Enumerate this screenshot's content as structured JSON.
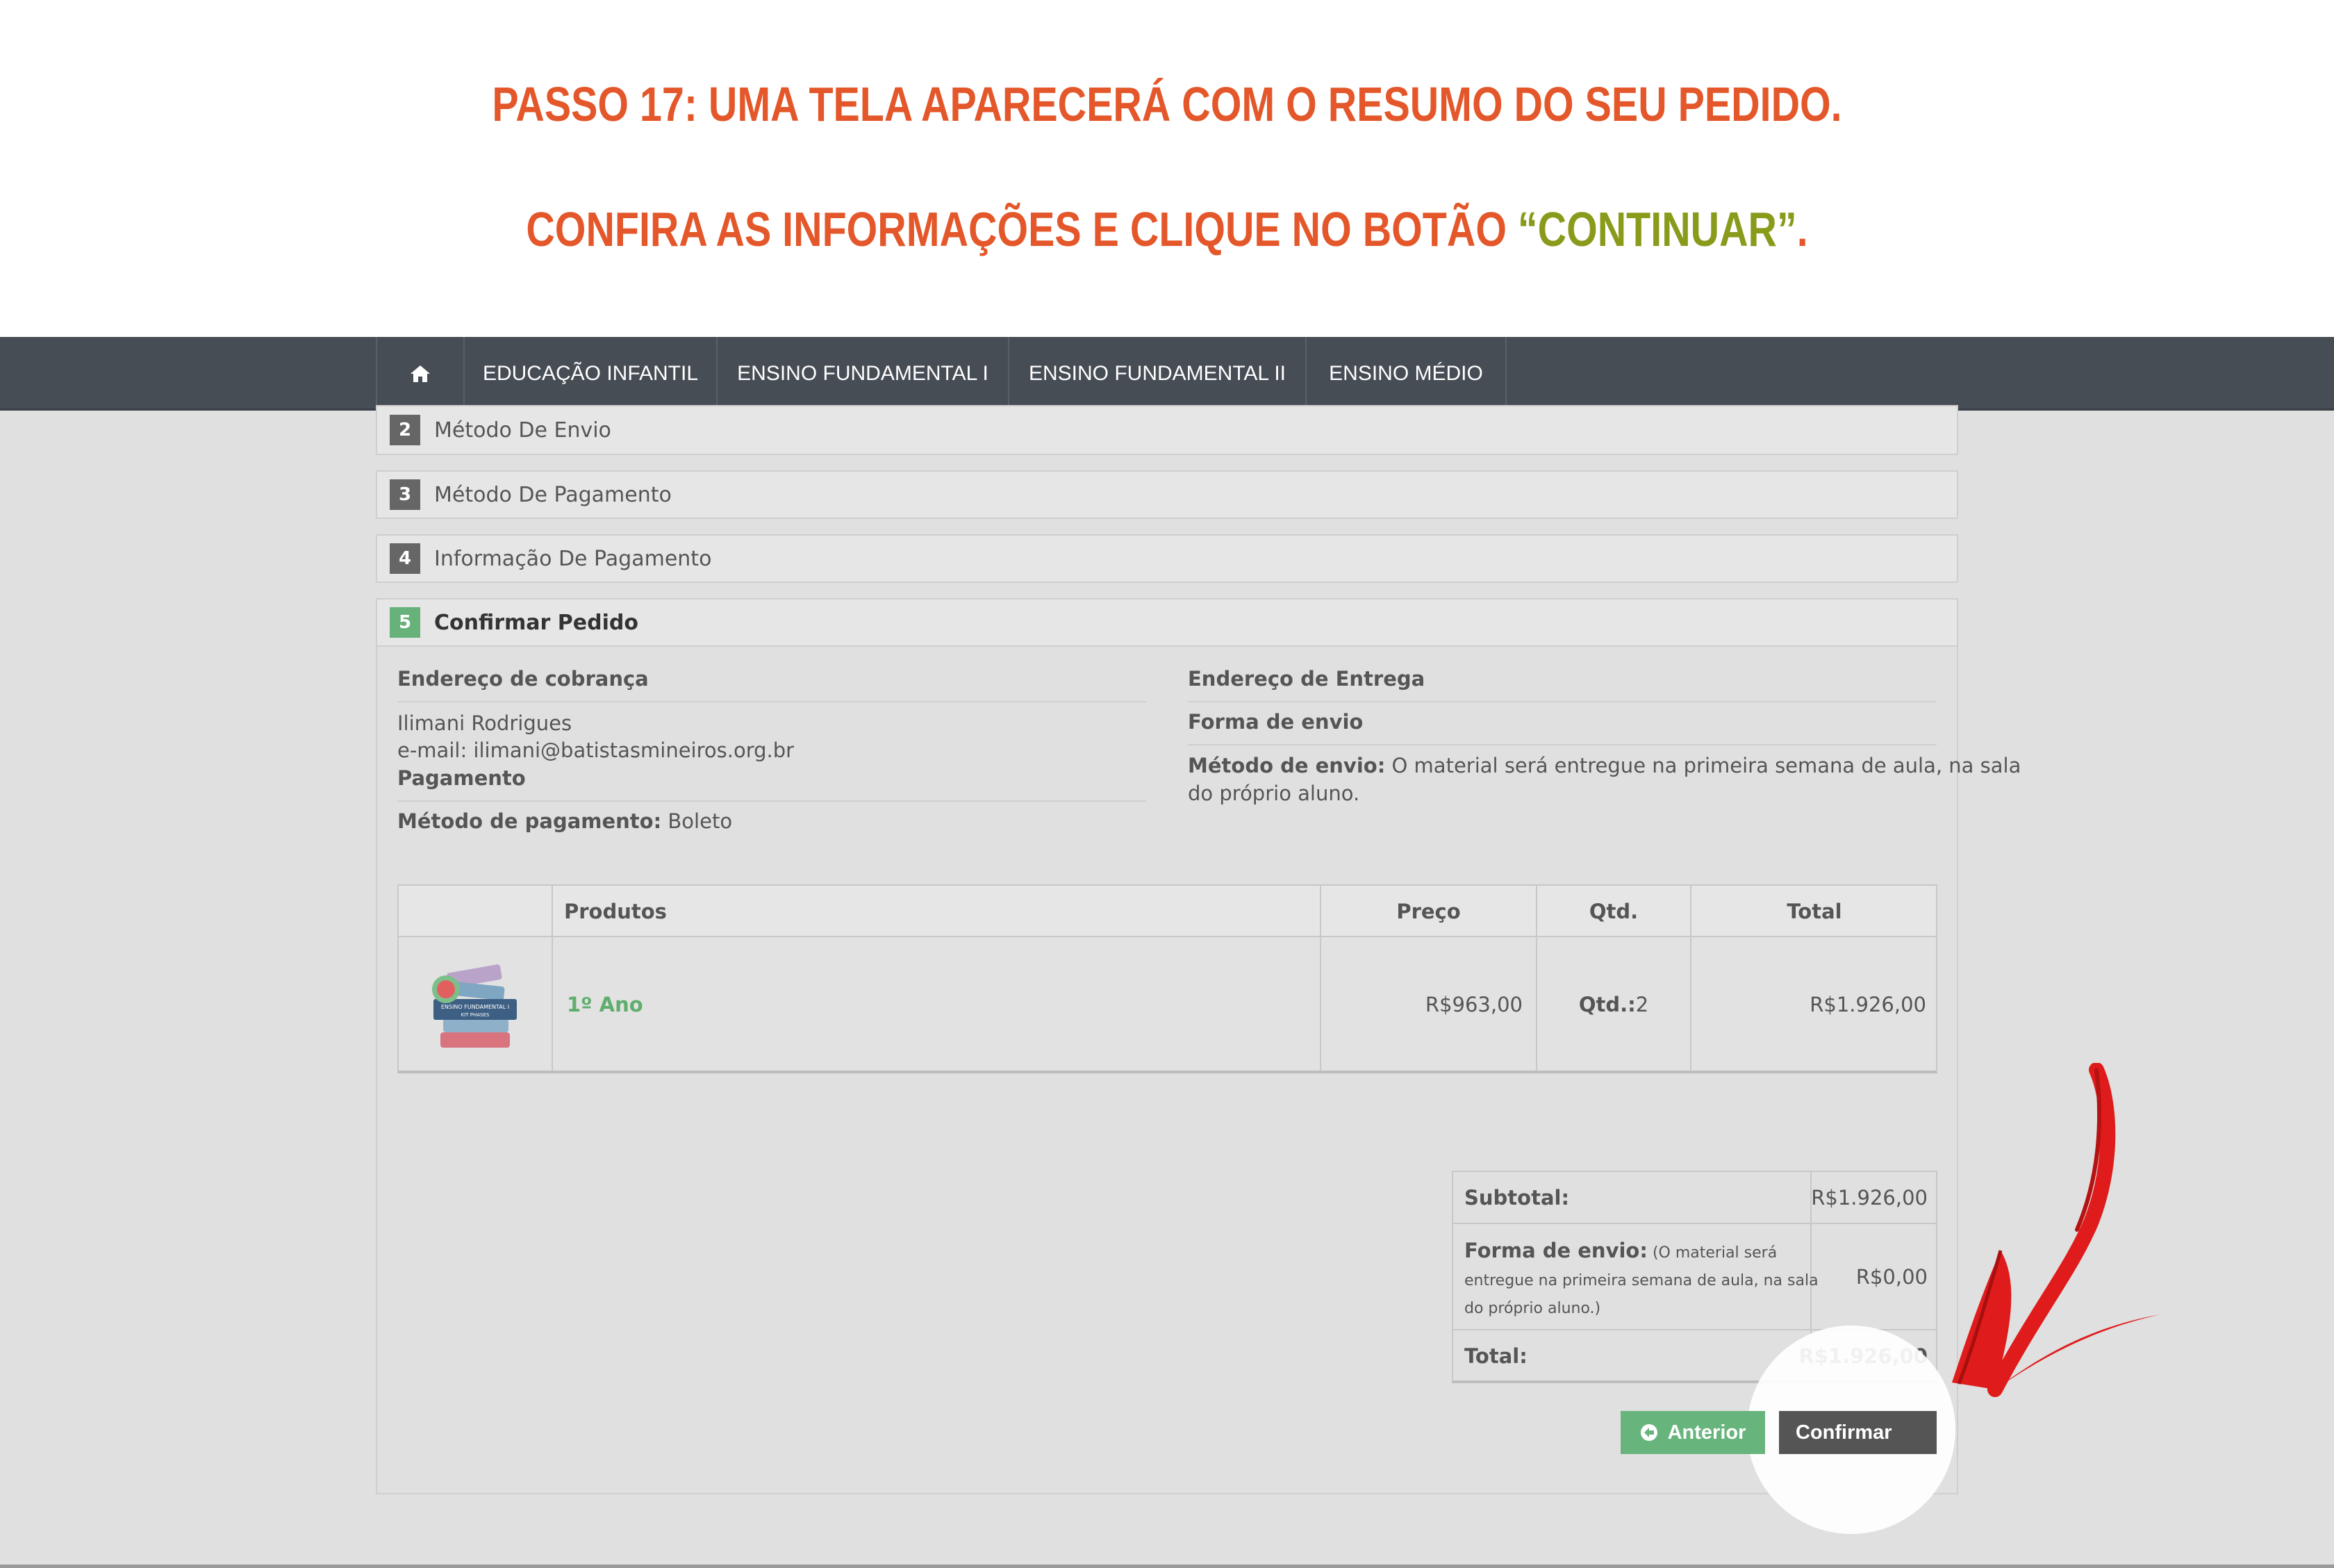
{
  "instruction": {
    "line1": "PASSO 17: UMA TELA APARECERÁ COM O RESUMO DO SEU PEDIDO.",
    "line2_prefix": "CONFIRA AS INFORMAÇÕES E CLIQUE NO BOTÃO ",
    "line2_highlight": "“CONTINUAR”",
    "line2_suffix": "."
  },
  "nav": {
    "home_icon": "home-icon",
    "items": [
      "EDUCAÇÃO INFANTIL",
      "ENSINO FUNDAMENTAL I",
      "ENSINO FUNDAMENTAL II",
      "ENSINO MÉDIO"
    ]
  },
  "steps": [
    {
      "num": "2",
      "label": "Método De Envio"
    },
    {
      "num": "3",
      "label": "Método De Pagamento"
    },
    {
      "num": "4",
      "label": "Informação De Pagamento"
    },
    {
      "num": "5",
      "label": "Confirmar Pedido"
    }
  ],
  "billing": {
    "title": "Endereço de cobrança",
    "name": "Ilimani Rodrigues",
    "email": "e-mail: ilimani@batistasmineiros.org.br",
    "payment_title": "Pagamento",
    "payment_method_label": "Método de pagamento:",
    "payment_method_value": " Boleto"
  },
  "delivery": {
    "title": "Endereço de Entrega",
    "shipping_title": "Forma de envio",
    "shipping_method_label": "Método de envio:",
    "shipping_method_value_1": " O material será entregue na primeira semana de aula, na sala",
    "shipping_method_value_2": "do próprio aluno."
  },
  "products_table": {
    "headers": {
      "products": "Produtos",
      "price": "Preço",
      "qty": "Qtd.",
      "total": "Total"
    },
    "rows": [
      {
        "name": "1º Ano",
        "price": "R$963,00",
        "qty_label": "Qtd.:",
        "qty_value": " 2",
        "total": "R$1.926,00"
      }
    ]
  },
  "totals": {
    "subtotal_label": "Subtotal:",
    "subtotal_value": "R$1.926,00",
    "shipping_label": "Forma de envio:",
    "shipping_note_1": " (O material será",
    "shipping_note_2": "entregue na primeira semana de aula, na sala",
    "shipping_note_3": "do próprio aluno.)",
    "shipping_value": "R$0,00",
    "total_label": "Total:",
    "total_value": "R$1.926,00"
  },
  "buttons": {
    "previous": "Anterior",
    "confirm": "Confirmar"
  },
  "colors": {
    "instruction_orange": "#e4572a",
    "instruction_green": "#8a9a1b",
    "nav_bg": "#474d55",
    "active_step": "#66b27a",
    "arrow_red": "#e01b1b"
  }
}
